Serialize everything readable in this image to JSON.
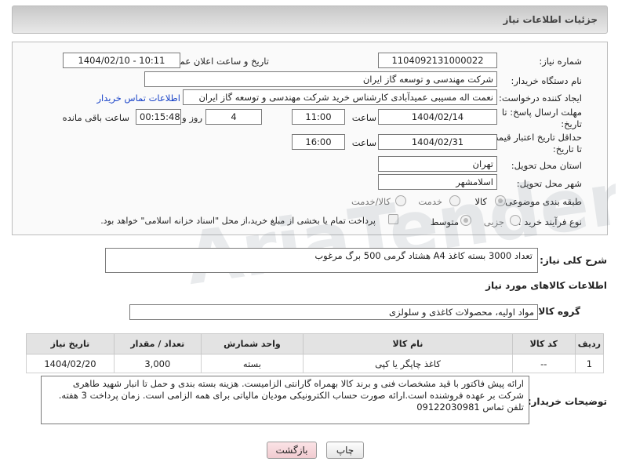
{
  "header": {
    "title": "جزئیات اطلاعات نیاز"
  },
  "form": {
    "need_number_label": "شماره نیاز:",
    "need_number": "1104092131000022",
    "announce_label": "تاریخ و ساعت اعلان عمومی:",
    "announce_value": "1404/02/10 - 10:11",
    "buyer_org_label": "نام دستگاه خریدار:",
    "buyer_org": "شرکت مهندسی و توسعه گاز ایران",
    "creator_label": "ایجاد کننده درخواست:",
    "creator": "نعمت اله مسیبی عمیدآبادی کارشناس خرید شرکت مهندسی و توسعه گاز ایران",
    "contact_link": "اطلاعات تماس خریدار",
    "reply_deadline_label_1": "مهلت ارسال پاسخ: تا",
    "reply_deadline_label_2": "تاریخ:",
    "reply_date": "1404/02/14",
    "time_label": "ساعت",
    "reply_time": "11:00",
    "days_value": "4",
    "days_label": "روز و",
    "remaining_time": "00:15:48",
    "remaining_label": "ساعت باقی مانده",
    "price_validity_label_1": "حداقل تاریخ اعتبار قیمت:",
    "price_validity_label_2": "تا تاریخ:",
    "price_date": "1404/02/31",
    "price_time": "16:00",
    "province_label": "استان محل تحویل:",
    "province": "تهران",
    "city_label": "شهر محل تحویل:",
    "city": "اسلامشهر",
    "category_label": "طبقه بندی موضوعی:",
    "category_options": [
      "کالا",
      "خدمت",
      "کالا/خدمت"
    ],
    "category_selected": "کالا",
    "process_label": "نوع فرآیند خرید :",
    "process_options": [
      "جزیی",
      "متوسط"
    ],
    "process_selected": "متوسط",
    "payment_note": "پرداخت تمام یا بخشی از مبلغ خرید،از محل \"اسناد خزانه اسلامی\" خواهد بود."
  },
  "description": {
    "label": "شرح کلی نیاز:",
    "value": "تعداد 3000 بسته کاغذ A4 هشتاد گرمی 500 برگ مرغوب"
  },
  "goods": {
    "section_title": "اطلاعات کالاهای مورد نیاز",
    "group_label": "گروه کالا:",
    "group_value": "مواد اولیه، محصولات کاغذی و سلولزی",
    "columns": [
      "ردیف",
      "کد کالا",
      "نام کالا",
      "واحد شمارش",
      "تعداد / مقدار",
      "تاریخ نیاز"
    ],
    "rows": [
      [
        "1",
        "--",
        "کاغذ چاپگر یا کپی",
        "بسته",
        "3,000",
        "1404/02/20"
      ]
    ]
  },
  "buyer_notes": {
    "label": "توضیحات خریدار:",
    "value": "ارائه پیش فاکتور با قید مشخصات فنی و برند کالا بهمراه گارانتی الزامیست. هزینه بسته بندی و حمل تا انبار شهید طاهری شرکت بر عهده فروشنده است.ارائه صورت حساب الکترونیکی مودیان مالیاتی برای همه الزامی است. زمان پرداخت 3 هفته. تلفن تماس 09122030981"
  },
  "buttons": {
    "print": "چاپ",
    "back": "بازگشت"
  },
  "watermark": {
    "text": "AriaTender.neT"
  },
  "colors": {
    "link": "#1a44c8",
    "header_bg": "#d6d6d6",
    "back_button": "#f4d2d6"
  }
}
